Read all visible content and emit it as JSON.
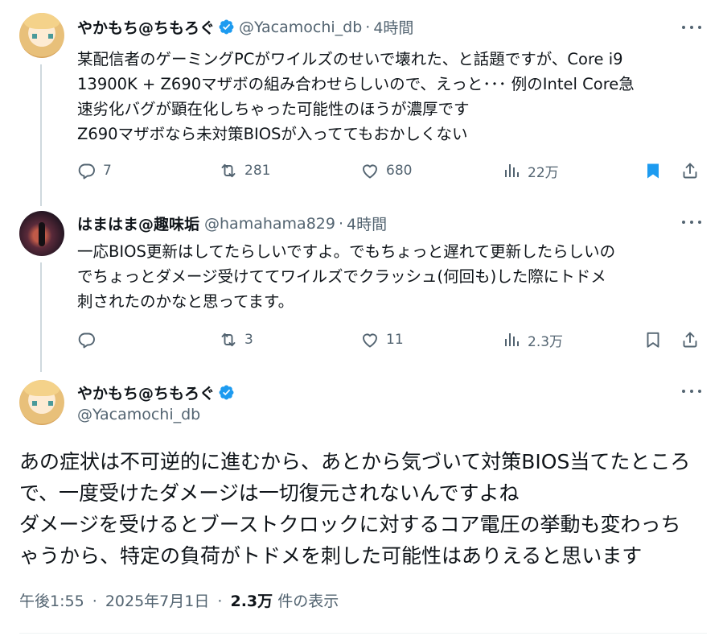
{
  "posts": [
    {
      "author_name": "やかもち@ちもろぐ",
      "handle": "@Yacamochi_db",
      "separator": "·",
      "time": "4時間",
      "text": "某配信者のゲーミングPCがワイルズのせいで壊れた、と話題ですが、Core i9\n13900K + Z690マザボの組み合わせらしいので、えっと･･･ 例のIntel Core急\n速劣化バグが顕在化しちゃった可能性のほうが濃厚です\nZ690マザボなら未対策BIOSが入っててもおかしくない",
      "replies": "7",
      "reposts": "281",
      "likes": "680",
      "views": "22万",
      "bookmarked": true
    },
    {
      "author_name": "はまはま@趣味垢",
      "handle": "@hamahama829",
      "separator": "·",
      "time": "4時間",
      "text": "一応BIOS更新はしてたらしいですよ。でもちょっと遅れて更新したらしいの\nでちょっとダメージ受けててワイルズでクラッシュ(何回も)した際にトドメ\n刺されたのかなと思ってます。",
      "replies": "",
      "reposts": "3",
      "likes": "11",
      "views": "2.3万",
      "bookmarked": false
    }
  ],
  "main_post": {
    "author_name": "やかもち@ちもろぐ",
    "handle": "@Yacamochi_db",
    "text": "あの症状は不可逆的に進むから、あとから気づいて対策BIOS当てたところ\nで、一度受けたダメージは一切復元されないんですよね\nダメージを受けるとブーストクロックに対するコア電圧の挙動も変わっち\nゃうから、特定の負荷がトドメを刺した可能性はありえると思います",
    "time": "午後1:55",
    "separator": "·",
    "date": "2025年7月1日",
    "views_count": "2.3万",
    "views_label": "件の表示"
  },
  "icons": {
    "verified": "verified-badge-icon",
    "reply": "reply-icon",
    "repost": "repost-icon",
    "like": "heart-icon",
    "views": "views-chart-icon",
    "bookmark": "bookmark-icon",
    "share": "share-icon",
    "more": "more-icon"
  },
  "colors": {
    "accent": "#1d9bf0",
    "text": "#0f1419",
    "secondary": "#536471",
    "thread_line": "#cfd9de"
  }
}
